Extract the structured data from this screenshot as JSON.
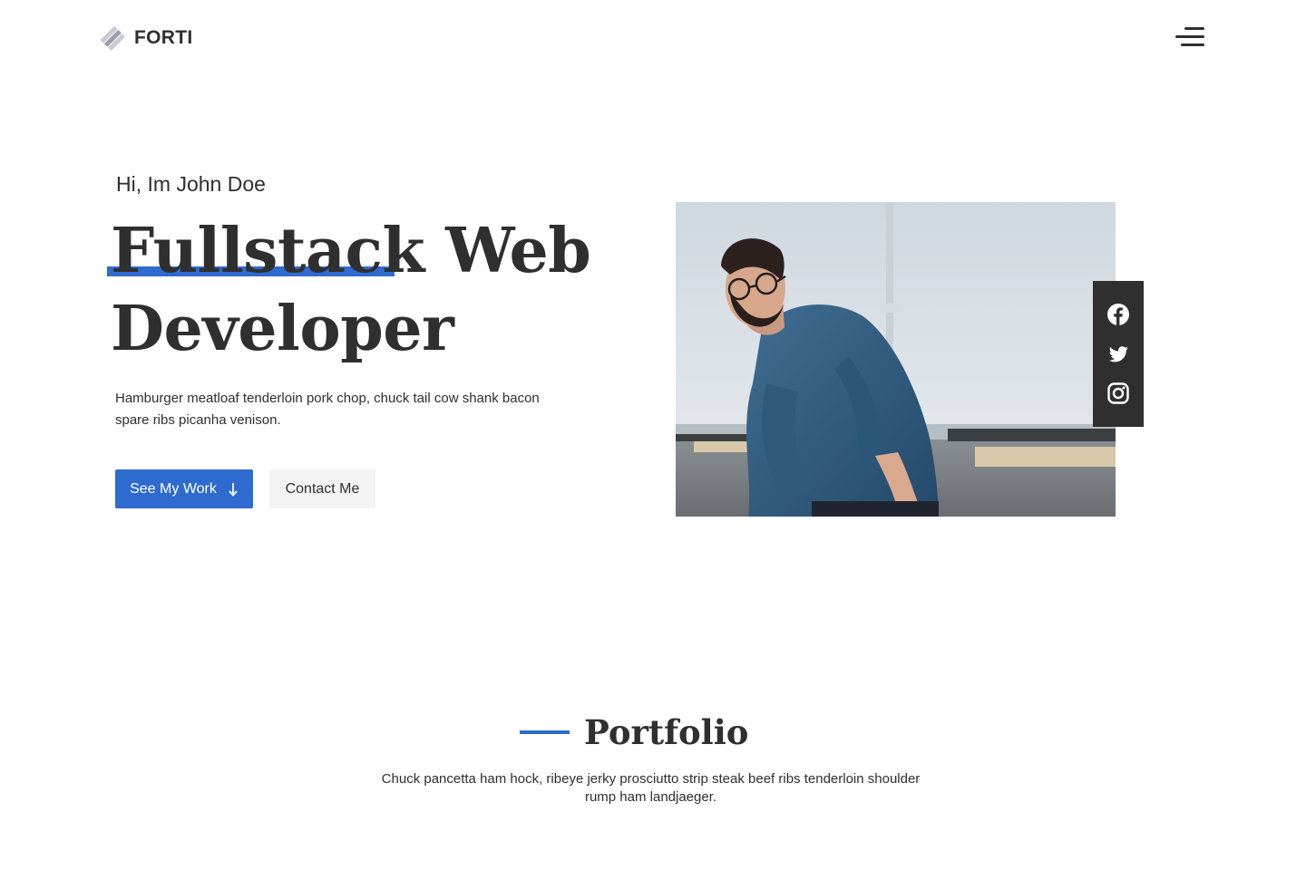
{
  "header": {
    "logo_text": "FORTI",
    "logo_icon": "diamond-stack-icon",
    "menu_icon": "hamburger-menu-icon"
  },
  "hero": {
    "greeting": "Hi, Im John Doe",
    "headline_line1_highlight": "Fullstack",
    "headline_line1_rest": " Web",
    "headline_line2": "Developer",
    "lead": "Hamburger meatloaf tenderloin pork chop, chuck tail cow shank bacon spare ribs picanha venison.",
    "primary_button": "See My Work",
    "primary_button_icon": "arrow-down-icon",
    "secondary_button": "Contact Me",
    "photo_subject": "portrait-photo"
  },
  "social": {
    "items": [
      {
        "icon": "facebook-icon"
      },
      {
        "icon": "twitter-icon"
      },
      {
        "icon": "instagram-icon"
      }
    ]
  },
  "portfolio": {
    "title": "Portfolio",
    "description": "Chuck pancetta ham hock, ribeye jerky prosciutto strip steak beef ribs tenderloin shoulder rump ham landjaeger."
  },
  "colors": {
    "accent": "#2f6bce",
    "text": "#2f2f2f",
    "social_bg": "#2f2f2f",
    "secondary_button_bg": "#f4f4f4"
  }
}
